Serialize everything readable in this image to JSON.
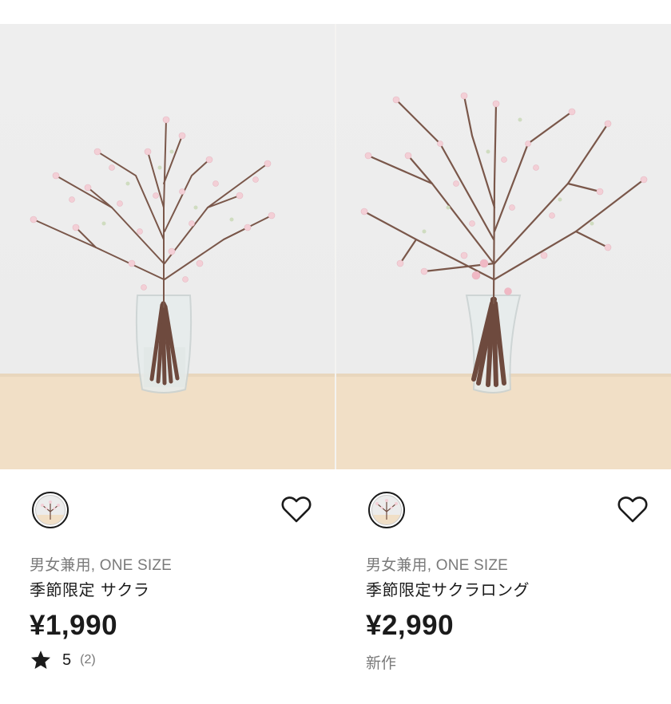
{
  "products": [
    {
      "image_alt": "桜の枝をガラス花瓶に活けた写真",
      "swatch_icon": "cherry-blossom-swatch",
      "favorite_icon": "heart-outline-icon",
      "meta": "男女兼用, ONE SIZE",
      "name": "季節限定 サクラ",
      "price": "¥1,990",
      "rating_icon": "star-icon",
      "rating_value": "5",
      "rating_count": "(2)"
    },
    {
      "image_alt": "長い桜の枝をガラス花瓶に活けた写真",
      "swatch_icon": "cherry-blossom-swatch",
      "favorite_icon": "heart-outline-icon",
      "meta": "男女兼用, ONE SIZE",
      "name": "季節限定サクラロング",
      "price": "¥2,990",
      "badge": "新作"
    }
  ],
  "colors": {
    "text": "#1b1b1b",
    "muted": "#7a7a7a",
    "photo_bg": "#ececec",
    "table": "#f1dfc6",
    "branch": "#6e4a3e",
    "blossom": "#f3cfd6"
  }
}
